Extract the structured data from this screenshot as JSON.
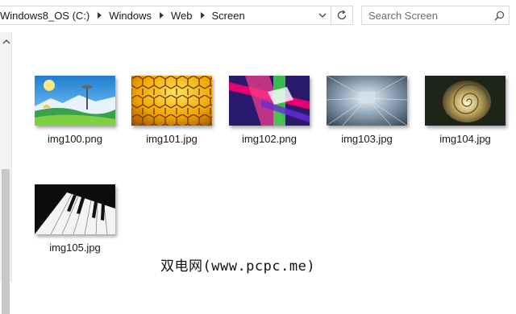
{
  "address_bar": {
    "crumbs": [
      "Windows8_OS (C:)",
      "Windows",
      "Web",
      "Screen"
    ]
  },
  "search": {
    "placeholder": "Search Screen"
  },
  "files": [
    {
      "name": "img100.png",
      "thumbnail": "seattle-space-needle-landscape"
    },
    {
      "name": "img101.jpg",
      "thumbnail": "golden-honeycomb"
    },
    {
      "name": "img102.png",
      "thumbnail": "colorful-abstract-ribbons"
    },
    {
      "name": "img103.jpg",
      "thumbnail": "motion-blur-corridor"
    },
    {
      "name": "img104.jpg",
      "thumbnail": "nautilus-shell"
    },
    {
      "name": "img105.jpg",
      "thumbnail": "piano-keys"
    }
  ],
  "watermark": "双电网(www.pcpc.me)",
  "icons": {
    "breadcrumb_separator": "chevron-right-icon",
    "history_dropdown": "chevron-down-icon",
    "refresh": "refresh-icon",
    "search": "search-icon",
    "nav_scroll_up": "chevron-up-icon"
  }
}
